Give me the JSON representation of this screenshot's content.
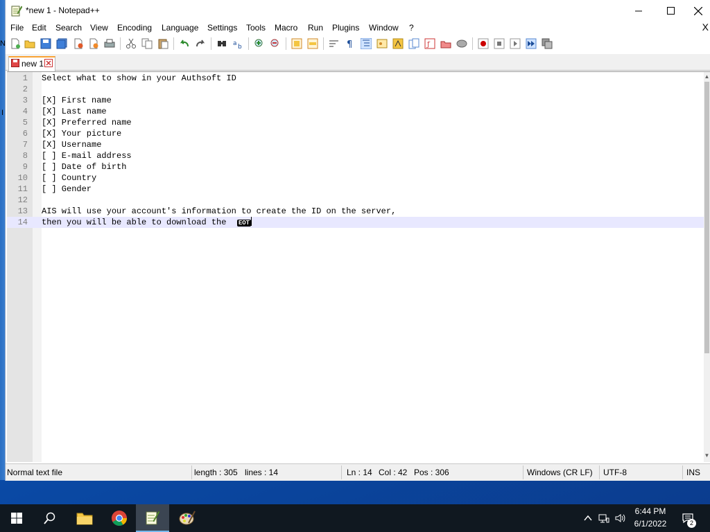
{
  "window": {
    "title": "*new 1 - Notepad++"
  },
  "menubar": {
    "items": [
      "File",
      "Edit",
      "Search",
      "View",
      "Encoding",
      "Language",
      "Settings",
      "Tools",
      "Macro",
      "Run",
      "Plugins",
      "Window",
      "?"
    ],
    "close_glyph": "X"
  },
  "tab": {
    "label": "new 1"
  },
  "editor": {
    "lines": [
      "Select what to show in your Authsoft ID",
      "",
      "[X] First name",
      "[X] Last name",
      "[X] Preferred name",
      "[X] Your picture",
      "[X] Username",
      "[ ] E-mail address",
      "[ ] Date of birth",
      "[ ] Country",
      "[ ] Gender",
      "",
      "AIS will use your account's information to create the ID on the server,",
      "then you will be able to download the  "
    ],
    "line_numbers": [
      "1",
      "2",
      "3",
      "4",
      "5",
      "6",
      "7",
      "8",
      "9",
      "10",
      "11",
      "12",
      "13",
      "14"
    ],
    "current_line": 14,
    "eot_marker": "EOT"
  },
  "statusbar": {
    "file_type": "Normal text file",
    "length": "length : 305",
    "lines": "lines : 14",
    "ln": "Ln : 14",
    "col": "Col : 42",
    "pos": "Pos : 306",
    "eol": "Windows (CR LF)",
    "encoding": "UTF-8",
    "mode": "INS"
  },
  "taskbar": {
    "time": "6:44 PM",
    "date": "6/1/2022",
    "notification_count": "2"
  },
  "left_edge": {
    "glyph_1": "N",
    "glyph_2": "I"
  },
  "colors": {
    "current_line": "#e8e8ff",
    "tab_accent": "#f9a234",
    "taskbar": "#101820"
  }
}
